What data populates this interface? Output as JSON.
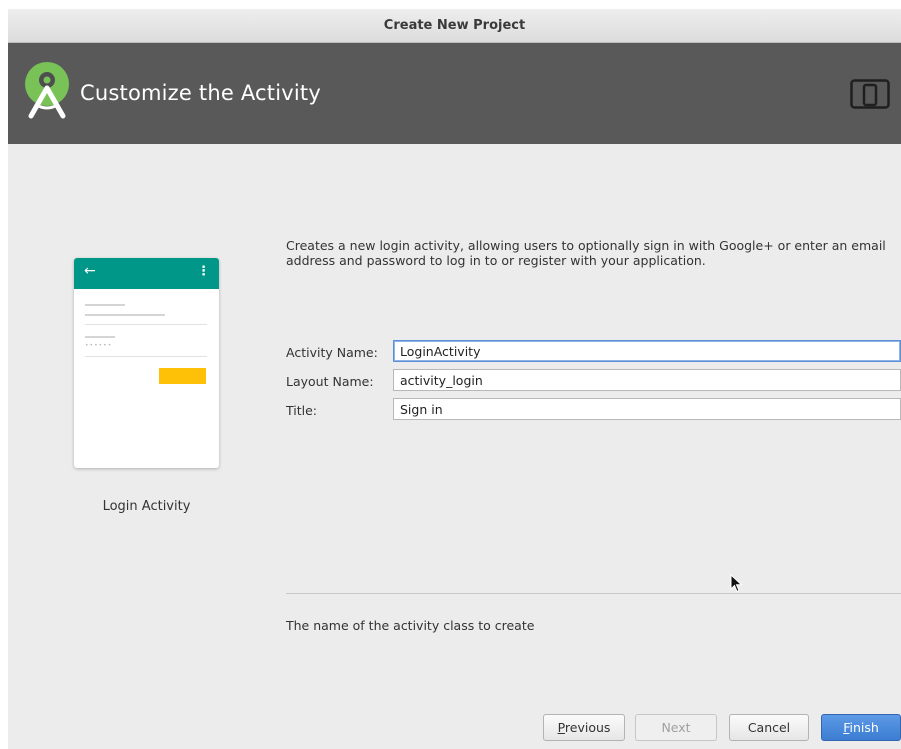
{
  "window": {
    "title": "Create New Project"
  },
  "header": {
    "title": "Customize the Activity",
    "logo_icon": "android-studio-logo-icon",
    "device_icon": "phone-tablet-icon",
    "background": "#595959"
  },
  "template_preview": {
    "label": "Login Activity",
    "appbar_color": "#009688",
    "button_color": "#ffc107",
    "back_icon": "←",
    "overflow_icon": "⋮",
    "password_dots": "••••••"
  },
  "description": "Creates a new login activity, allowing users to optionally sign in with Google+ or enter an email address and password to log in to or register with your application.",
  "form": {
    "fields": [
      {
        "label": "Activity Name:",
        "value": "LoginActivity"
      },
      {
        "label": "Layout Name:",
        "value": "activity_login"
      },
      {
        "label": "Title:",
        "value": "Sign in"
      }
    ]
  },
  "help_text": "The name of the activity class to create",
  "buttons": {
    "previous": {
      "mnemonic": "P",
      "rest": "revious"
    },
    "next": "Next",
    "cancel": "Cancel",
    "finish": {
      "mnemonic": "F",
      "rest": "inish"
    }
  }
}
